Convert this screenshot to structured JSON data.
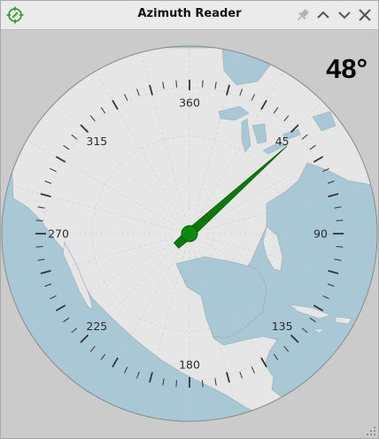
{
  "window": {
    "title": "Azimuth Reader",
    "app_icon": "compass-target-icon",
    "controls": [
      "pin-icon",
      "chevron-up-icon",
      "chevron-down-icon",
      "close-icon"
    ]
  },
  "readout": {
    "azimuth_text": "48°",
    "azimuth_value": 48
  },
  "dial": {
    "labels": [
      {
        "angle": 0,
        "text": "360"
      },
      {
        "angle": 45,
        "text": "45"
      },
      {
        "angle": 90,
        "text": "90"
      },
      {
        "angle": 135,
        "text": "135"
      },
      {
        "angle": 180,
        "text": "180"
      },
      {
        "angle": 225,
        "text": "225"
      },
      {
        "angle": 270,
        "text": "270"
      },
      {
        "angle": 315,
        "text": "315"
      }
    ],
    "minor_tick_step_deg": 5,
    "major_tick_step_deg": 15
  },
  "colors": {
    "needle": "#0b7a0b",
    "needle_hub": "#0d8a0d",
    "water": "#a9c8d6",
    "land": "#e6e6e6",
    "icon_green": "#2fa52f"
  }
}
